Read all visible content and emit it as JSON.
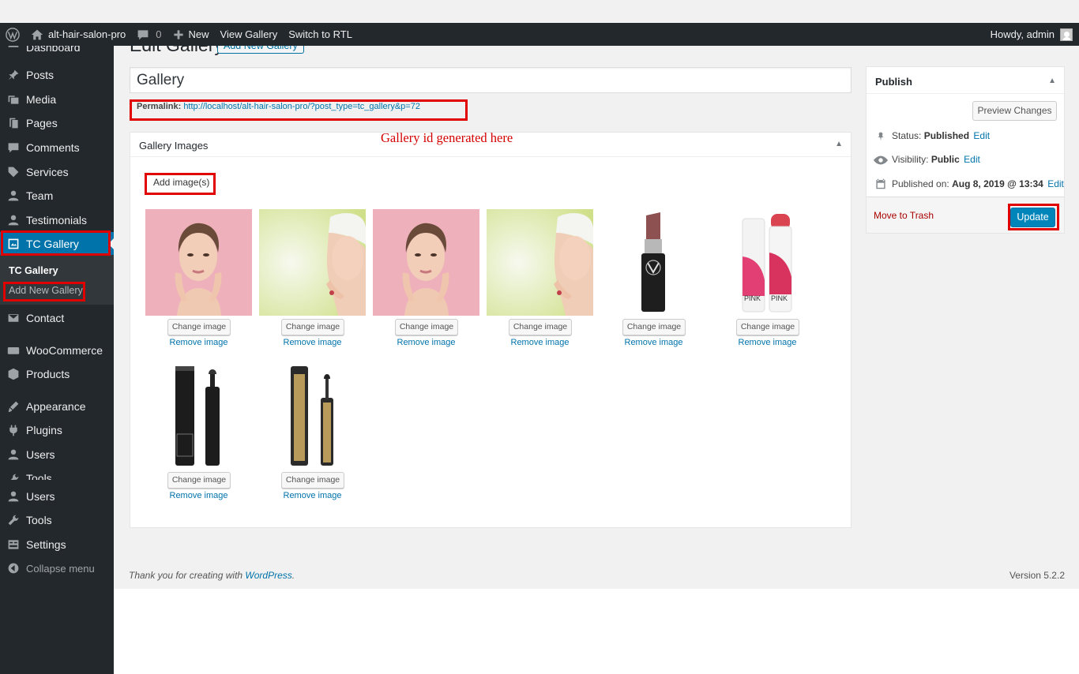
{
  "admin_bar": {
    "site_name": "alt-hair-salon-pro",
    "comments_count": "0",
    "new_label": "New",
    "view_gallery": "View Gallery",
    "switch_rtl": "Switch to RTL",
    "howdy": "Howdy, admin"
  },
  "sidebar": {
    "items": [
      {
        "label": "Dashboard",
        "icon": "dashboard-icon"
      },
      {
        "label": "Posts",
        "icon": "pin-icon"
      },
      {
        "label": "Media",
        "icon": "media-icon"
      },
      {
        "label": "Pages",
        "icon": "pages-icon"
      },
      {
        "label": "Comments",
        "icon": "comment-icon"
      },
      {
        "label": "Services",
        "icon": "tag-icon"
      },
      {
        "label": "Team",
        "icon": "user-icon"
      },
      {
        "label": "Testimonials",
        "icon": "user-icon"
      },
      {
        "label": "TC Gallery",
        "icon": "gallery-icon"
      },
      {
        "label": "Contact",
        "icon": "email-icon"
      },
      {
        "label": "WooCommerce",
        "icon": "woo-icon"
      },
      {
        "label": "Products",
        "icon": "products-icon"
      },
      {
        "label": "Appearance",
        "icon": "brush-icon"
      },
      {
        "label": "Plugins",
        "icon": "plugin-icon"
      },
      {
        "label": "Users",
        "icon": "user-icon"
      },
      {
        "label": "Tools",
        "icon": "wrench-icon"
      },
      {
        "label": "Users",
        "icon": "user-icon"
      },
      {
        "label": "Tools",
        "icon": "wrench-icon"
      },
      {
        "label": "Settings",
        "icon": "settings-icon"
      },
      {
        "label": "Collapse menu",
        "icon": "collapse-icon"
      }
    ],
    "submenu": {
      "current": "TC Gallery",
      "add_new": "Add New Gallery"
    }
  },
  "page": {
    "heading": "Edit Gallery",
    "add_new_button": "Add New Gallery",
    "title_value": "Gallery",
    "permalink_label": "Permalink:",
    "permalink_url": "http://localhost/alt-hair-salon-pro/?post_type=tc_gallery&p=72",
    "annotation": "Gallery id  generated here"
  },
  "gallery_box": {
    "title": "Gallery Images",
    "add_images": "Add image(s)",
    "change_label": "Change image",
    "remove_label": "Remove image",
    "images": [
      {
        "kind": "woman-pink"
      },
      {
        "kind": "woman-towel"
      },
      {
        "kind": "woman-pink"
      },
      {
        "kind": "woman-towel"
      },
      {
        "kind": "lipstick-dark"
      },
      {
        "kind": "lipgloss-pink",
        "text": "PINK"
      },
      {
        "kind": "mascara-black"
      },
      {
        "kind": "mascara-gold"
      }
    ]
  },
  "publish": {
    "title": "Publish",
    "preview": "Preview Changes",
    "status_label": "Status:",
    "status_value": "Published",
    "visibility_label": "Visibility:",
    "visibility_value": "Public",
    "published_label": "Published on:",
    "published_value": "Aug 8, 2019 @ 13:34",
    "edit": "Edit",
    "trash": "Move to Trash",
    "update": "Update"
  },
  "footer": {
    "thanks_prefix": "Thank you for creating with ",
    "wordpress_link": "WordPress",
    "thanks_suffix": ".",
    "version": "Version 5.2.2"
  },
  "colors": {
    "accent": "#0073aa",
    "admin_dark": "#23282d",
    "highlight_red": "#e00000"
  }
}
